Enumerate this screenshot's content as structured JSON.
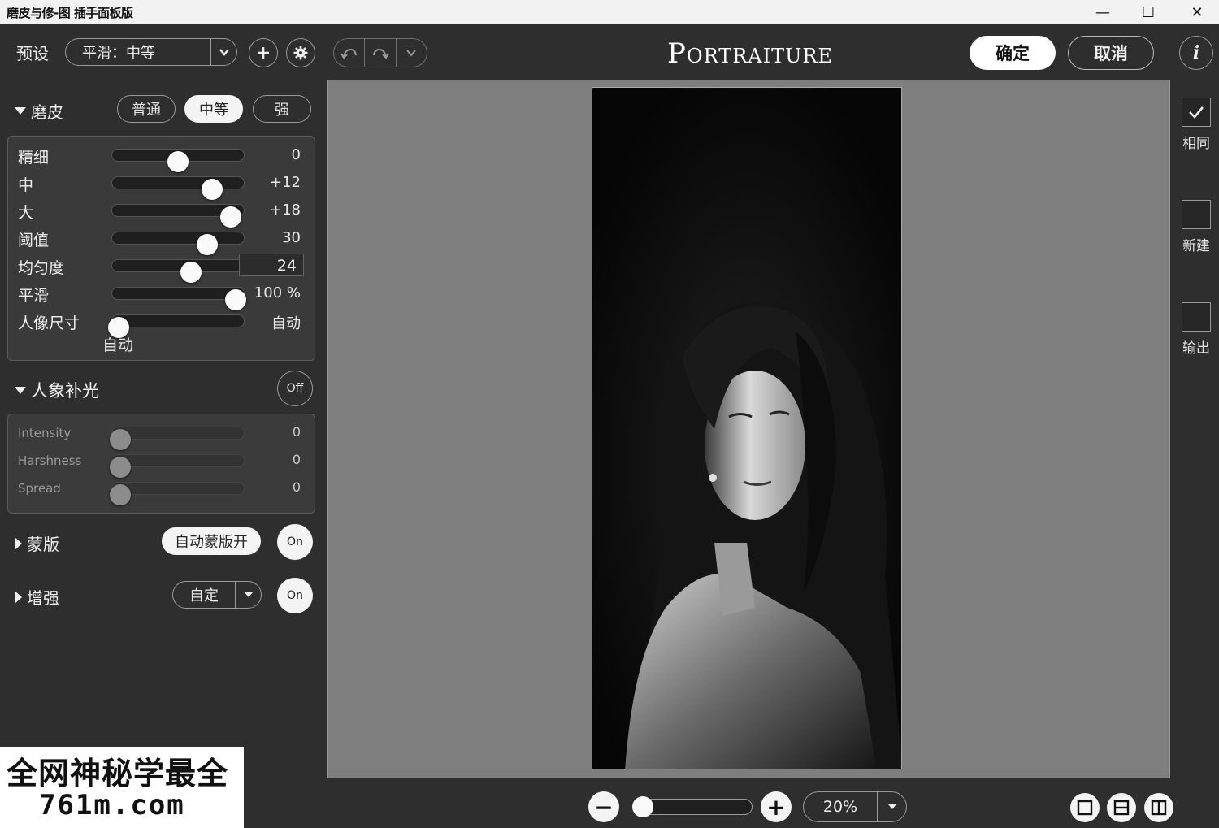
{
  "window": {
    "title": "磨皮与修-图 插手面板版",
    "minimize": "—",
    "maximize": "☐",
    "close": "✕"
  },
  "toolbar": {
    "preset_label": "预设",
    "preset_value": "平滑：中等",
    "brand": "Portraiture",
    "ok_label": "确定",
    "cancel_label": "取消",
    "info_label": "i"
  },
  "skin": {
    "title": "磨皮",
    "strength_options": [
      "普通",
      "中等",
      "强"
    ],
    "selected_option": "中等",
    "sliders": [
      {
        "label": "精细",
        "value": "0",
        "level": 0.5
      },
      {
        "label": "中",
        "value": "+12",
        "level": 0.76
      },
      {
        "label": "大",
        "value": "+18",
        "level": 0.9
      },
      {
        "label": "阈值",
        "value": "30",
        "level": 0.72
      },
      {
        "label": "均匀度",
        "value": "24",
        "level": 0.6
      },
      {
        "label": "平滑",
        "value": "100 %",
        "level": 0.94
      },
      {
        "label": "人像尺寸",
        "value": "自动",
        "level": 0.05
      }
    ],
    "size_sub": "自动"
  },
  "relight": {
    "title": "人象补光",
    "toggle": "Off",
    "sliders": [
      {
        "label": "Intensity",
        "value": "0"
      },
      {
        "label": "Harshness",
        "value": "0"
      },
      {
        "label": "Spread",
        "value": "0"
      }
    ]
  },
  "mask": {
    "title": "蒙版",
    "auto_label": "自动蒙版开",
    "toggle": "On"
  },
  "enhance": {
    "title": "增强",
    "select_value": "自定",
    "toggle": "On"
  },
  "right_panel": {
    "same": "相同",
    "new": "新建",
    "output": "输出"
  },
  "bottom": {
    "zoom_value": "20%",
    "zoom_level": 0.07,
    "minus": "−",
    "plus": "+"
  },
  "watermark": {
    "line1": "全网神秘学最全",
    "line2": "761m.com"
  }
}
